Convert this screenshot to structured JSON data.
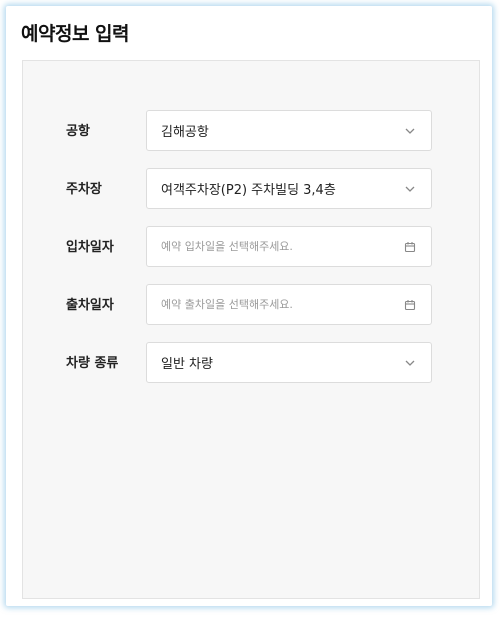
{
  "header": {
    "title": "예약정보 입력"
  },
  "form": {
    "airport": {
      "label": "공항",
      "value": "김해공항",
      "icon": "chevron-down-icon"
    },
    "parking": {
      "label": "주차장",
      "value": "여객주차장(P2) 주차빌딩 3,4층",
      "icon": "chevron-down-icon"
    },
    "entry_date": {
      "label": "입차일자",
      "value": "",
      "placeholder": "예약 입차일을 선택해주세요.",
      "icon": "calendar-icon"
    },
    "exit_date": {
      "label": "출차일자",
      "value": "",
      "placeholder": "예약 출차일을 선택해주세요.",
      "icon": "calendar-icon"
    },
    "vehicle_type": {
      "label": "차량 종류",
      "value": "일반 차량",
      "icon": "chevron-down-icon"
    }
  },
  "colors": {
    "frame_glow": "#78b9e1",
    "panel_bg": "#f7f7f7",
    "field_border": "#dcdcdc",
    "placeholder": "#9a9a9a"
  }
}
